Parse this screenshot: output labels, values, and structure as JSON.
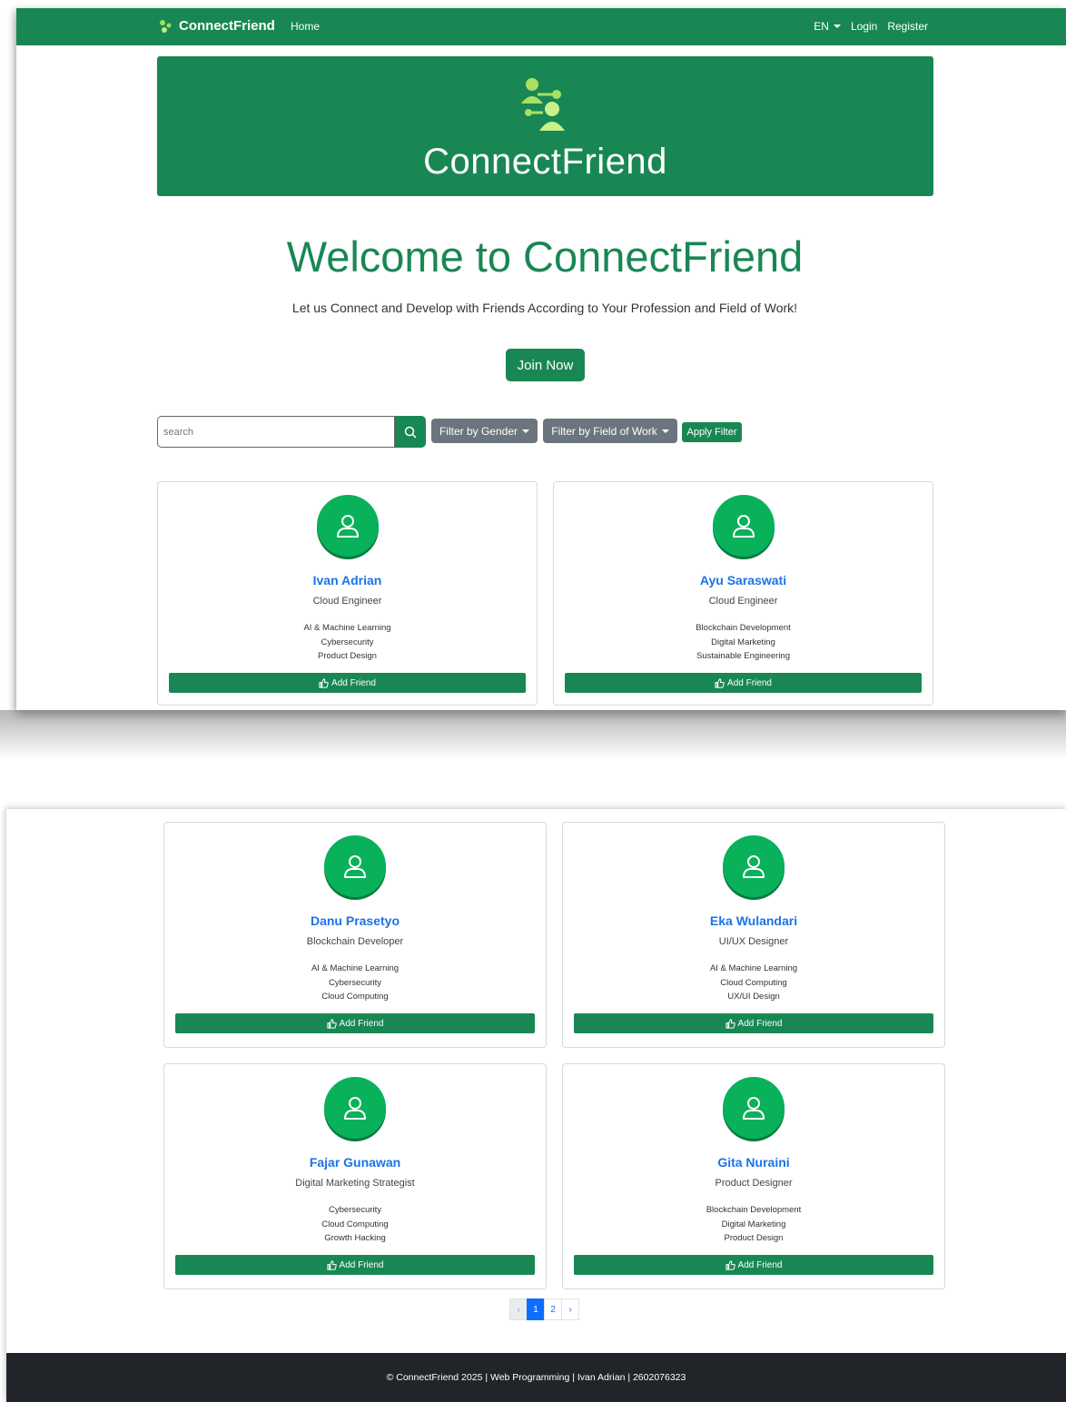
{
  "navbar": {
    "brand": "ConnectFriend",
    "home": "Home",
    "language": "EN",
    "login": "Login",
    "register": "Register"
  },
  "banner": {
    "title": "ConnectFriend"
  },
  "hero": {
    "title": "Welcome to ConnectFriend",
    "tagline": "Let us Connect and Develop with Friends According to Your Profession and Field of Work!",
    "join_button": "Join Now"
  },
  "filters": {
    "search_placeholder": "search",
    "gender": "Filter by Gender",
    "field": "Filter by Field of Work",
    "apply": "Apply Filter"
  },
  "add_friend_label": "Add Friend",
  "users": [
    {
      "name": "Ivan Adrian",
      "profession": "Cloud Engineer",
      "fields": [
        "AI & Machine Learning",
        "Cybersecurity",
        "Product Design"
      ]
    },
    {
      "name": "Ayu Saraswati",
      "profession": "Cloud Engineer",
      "fields": [
        "Blockchain Development",
        "Digital Marketing",
        "Sustainable Engineering"
      ]
    },
    {
      "name": "Danu Prasetyo",
      "profession": "Blockchain Developer",
      "fields": [
        "AI & Machine Learning",
        "Cybersecurity",
        "Cloud Computing"
      ]
    },
    {
      "name": "Eka Wulandari",
      "profession": "UI/UX Designer",
      "fields": [
        "AI & Machine Learning",
        "Cloud Computing",
        "UX/UI Design"
      ]
    },
    {
      "name": "Fajar Gunawan",
      "profession": "Digital Marketing Strategist",
      "fields": [
        "Cybersecurity",
        "Cloud Computing",
        "Growth Hacking"
      ]
    },
    {
      "name": "Gita Nuraini",
      "profession": "Product Designer",
      "fields": [
        "Blockchain Development",
        "Digital Marketing",
        "Product Design"
      ]
    }
  ],
  "pagination": {
    "prev": "‹",
    "pages": [
      "1",
      "2"
    ],
    "next": "›",
    "active": "1"
  },
  "footer": {
    "text": "© ConnectFriend 2025 | Web Programming | Ivan Adrian | 2602076323"
  },
  "colors": {
    "brand_green": "#198754",
    "avatar_green": "#08b15a",
    "name_blue": "#1a73e8",
    "filter_gray": "#6c757d",
    "footer_dark": "#212529"
  }
}
